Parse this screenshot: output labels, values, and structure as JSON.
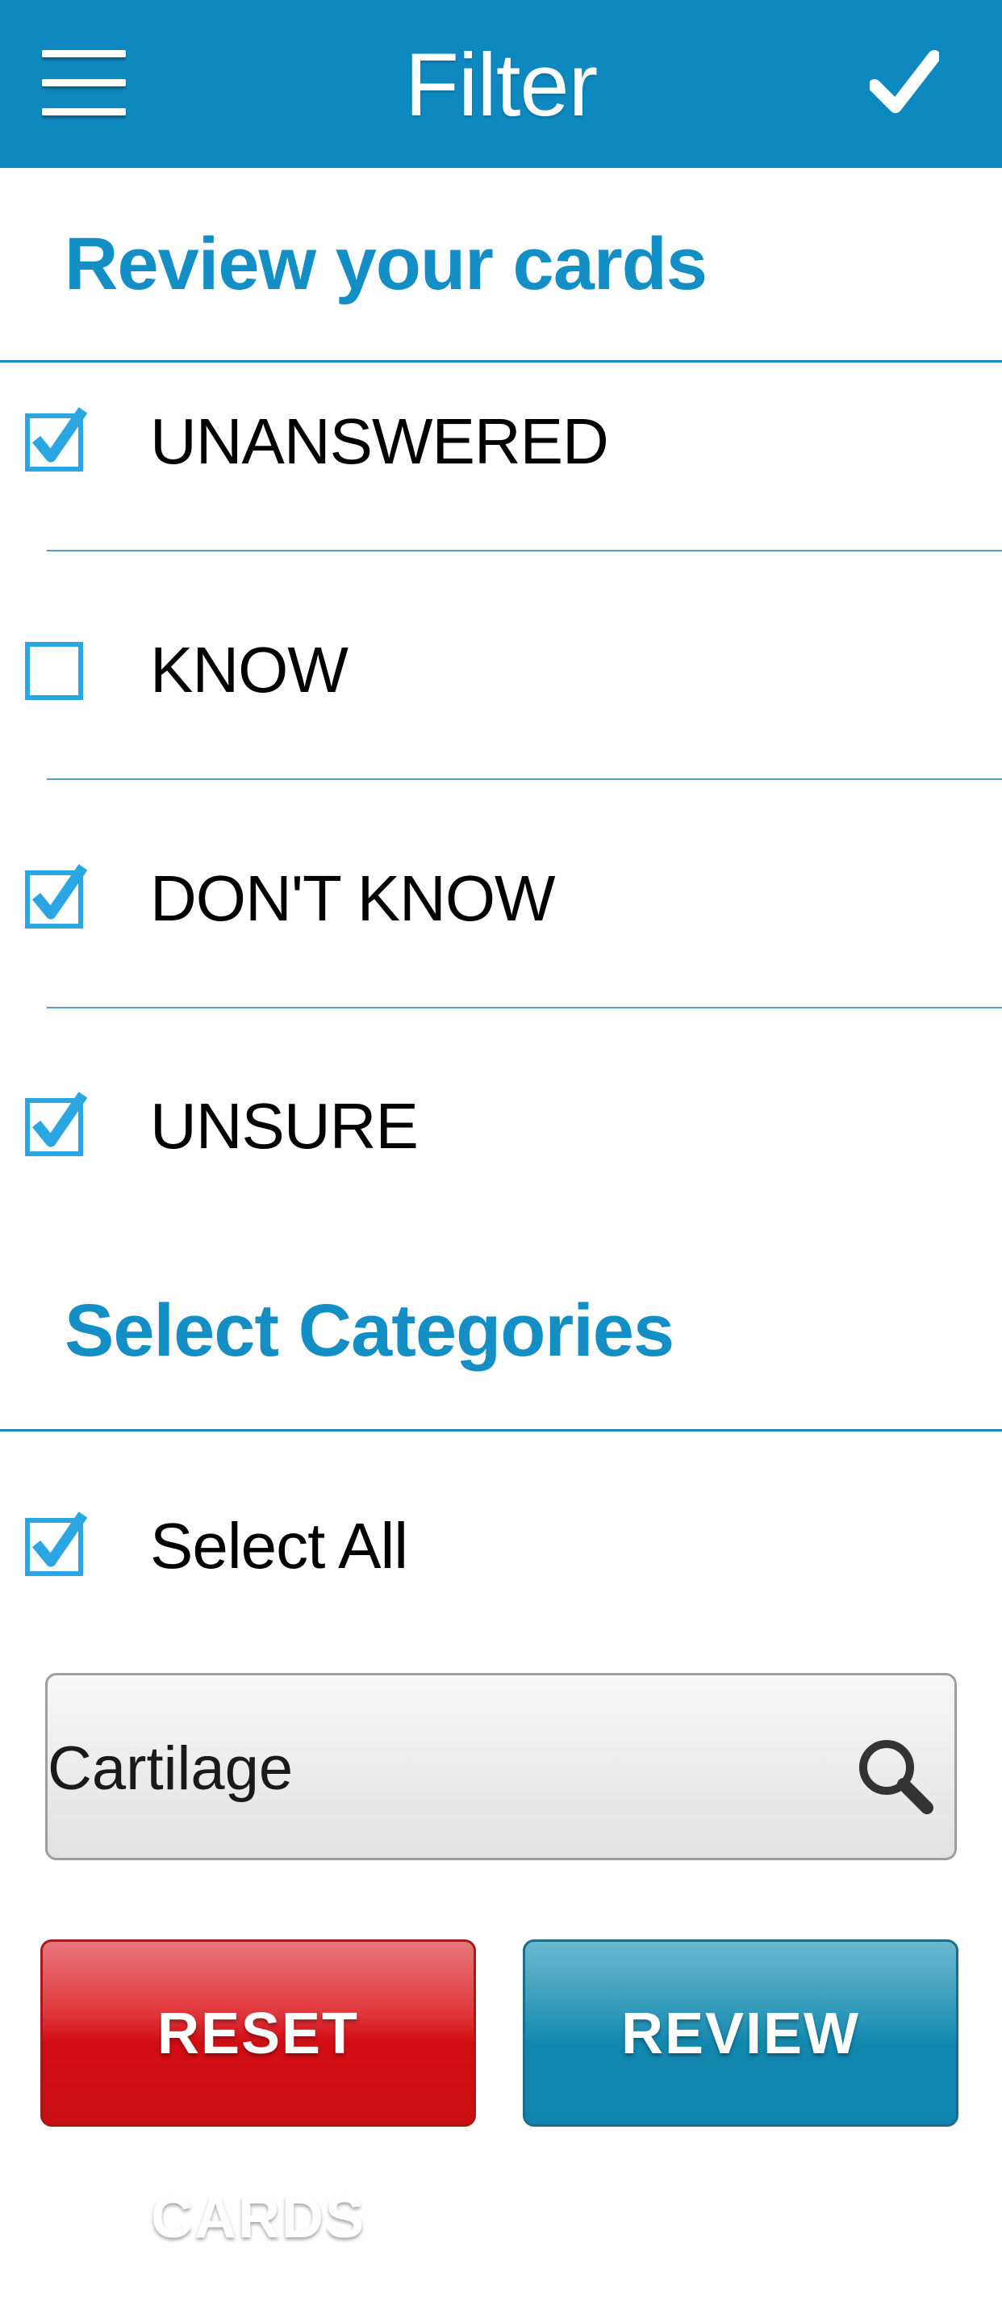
{
  "header": {
    "title": "Filter",
    "menu_icon": "hamburger-menu-icon",
    "confirm_icon": "checkmark-icon",
    "color": "#0e89c0"
  },
  "review": {
    "title": "Review your cards",
    "options": [
      {
        "label": "UNANSWERED",
        "checked": true
      },
      {
        "label": "KNOW",
        "checked": false
      },
      {
        "label": "DON'T KNOW",
        "checked": true
      },
      {
        "label": "UNSURE",
        "checked": true
      }
    ]
  },
  "categories": {
    "title": "Select Categories",
    "select_all": {
      "label": "Select All",
      "checked": true
    },
    "search_value": "Cartilage",
    "search_icon": "search-icon"
  },
  "buttons": {
    "reset_label": "RESET CARDS",
    "review_label": "REVIEW",
    "reset_color": "#d10d12",
    "review_color": "#1187ae"
  },
  "accent_color": "#148fc6"
}
